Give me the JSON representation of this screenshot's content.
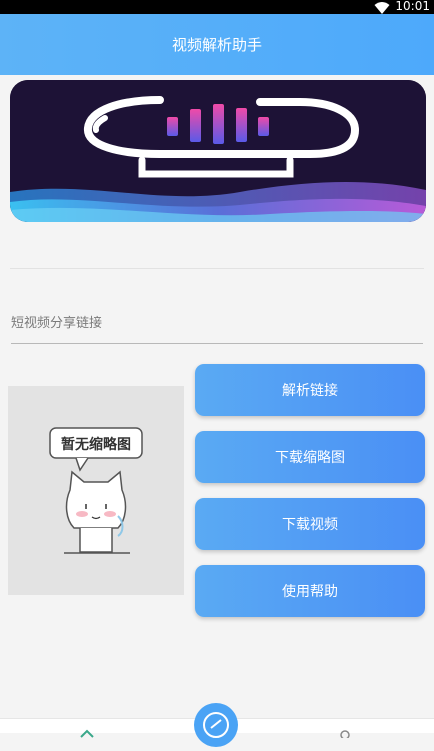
{
  "status_bar": {
    "time": "10:01",
    "wifi_icon": "wifi-icon"
  },
  "app_bar": {
    "title": "视频解析助手"
  },
  "input": {
    "placeholder": "短视频分享链接",
    "value": ""
  },
  "thumbnail": {
    "caption": "暂无缩略图"
  },
  "buttons": {
    "parse": "解析链接",
    "download_thumb": "下载缩略图",
    "download_video": "下载视频",
    "help": "使用帮助"
  },
  "bottom_nav": {
    "left_icon": "home-icon",
    "center_icon": "parse-icon",
    "right_icon": "user-icon"
  },
  "colors": {
    "accent": "#4da9fb",
    "button_start": "#5aaaf3",
    "button_end": "#4a8ff5"
  }
}
